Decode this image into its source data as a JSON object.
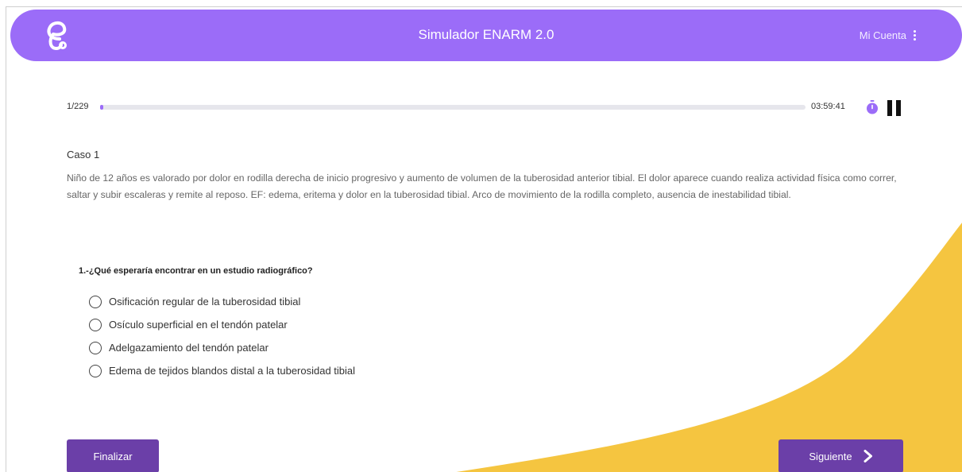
{
  "header": {
    "title": "Simulador ENARM 2.0",
    "account_label": "Mi Cuenta"
  },
  "progress": {
    "counter": "1/229",
    "fraction_complete": 0.0044,
    "timer": "03:59:41"
  },
  "case": {
    "title": "Caso 1",
    "text": "Niño de 12 años es valorado por dolor en rodilla derecha de inicio progresivo y aumento de volumen de la tuberosidad anterior tibial. El dolor aparece cuando realiza actividad física como correr, saltar y subir escaleras y remite al reposo. EF: edema, eritema y dolor en la tuberosidad tibial. Arco de movimiento de la rodilla completo, ausencia de inestabilidad tibial."
  },
  "question": {
    "text": "1.-¿Qué esperaría encontrar en un estudio radiográfico?",
    "options": [
      "Osificación regular de la tuberosidad tibial",
      "Osículo superficial en el tendón patelar",
      "Adelgazamiento del tendón patelar",
      "Edema de tejidos blandos distal a la tuberosidad tibial"
    ]
  },
  "buttons": {
    "finish_label": "Finalizar",
    "next_label": "Siguiente"
  },
  "colors": {
    "header": "#9b6cf8",
    "button": "#6b3fa8",
    "accent_wave": "#f5c540"
  },
  "icons": [
    "logo-icon",
    "kebab-menu-icon",
    "stopwatch-icon",
    "pause-icon",
    "chevron-right-icon"
  ]
}
